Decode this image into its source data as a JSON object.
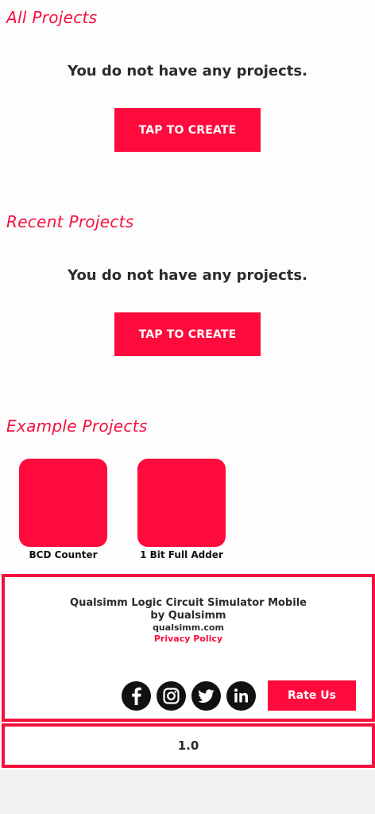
{
  "all_projects": {
    "title": "All Projects",
    "empty_message": "You do not have any projects.",
    "create_label": "TAP TO CREATE"
  },
  "recent_projects": {
    "title": "Recent Projects",
    "empty_message": "You do not have any projects.",
    "create_label": "TAP TO CREATE"
  },
  "example_projects": {
    "title": "Example Projects",
    "items": [
      {
        "label": "BCD Counter"
      },
      {
        "label": "1 Bit Full Adder"
      }
    ]
  },
  "info": {
    "app_name": "Qualsimm Logic Circuit Simulator Mobile",
    "author": "by Qualsimm",
    "website": "qualsimm.com",
    "privacy_label": "Privacy Policy",
    "social_icons": [
      "facebook-icon",
      "instagram-icon",
      "twitter-icon",
      "linkedin-icon"
    ],
    "rate_label": "Rate Us"
  },
  "version": "1.0",
  "colors": {
    "accent": "#ff0a3c",
    "title_accent": "#f5103f",
    "text_dark": "#2b2b2b",
    "icon_bg": "#111111"
  }
}
